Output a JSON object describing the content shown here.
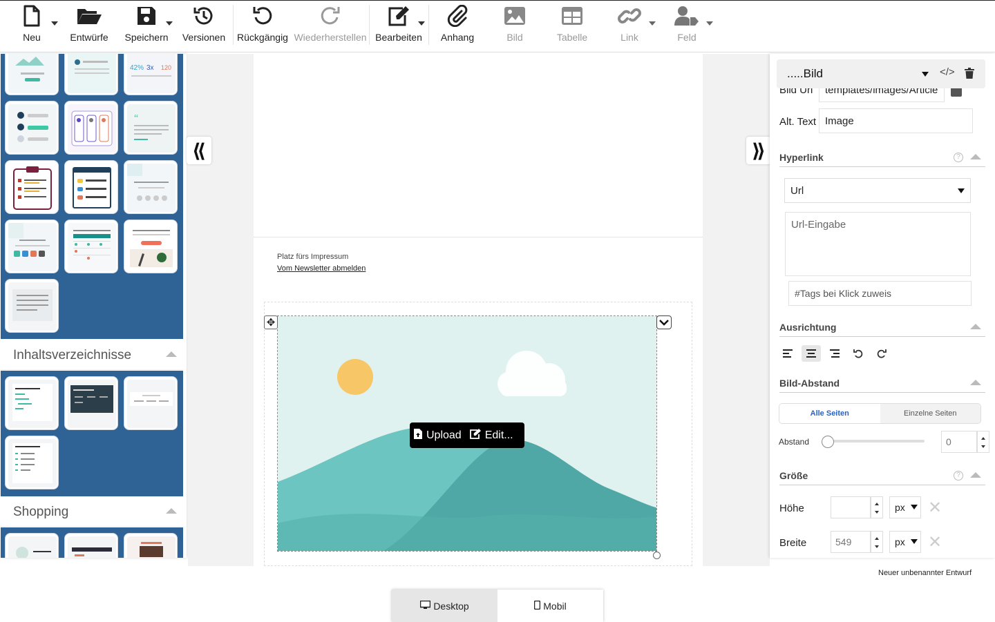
{
  "toolbar": {
    "new": "Neu",
    "drafts": "Entwürfe",
    "save": "Speichern",
    "versions": "Versionen",
    "undo": "Rückgängig",
    "redo": "Wiederherstellen",
    "edit": "Bearbeiten",
    "attachment": "Anhang",
    "image": "Bild",
    "table": "Tabelle",
    "link": "Link",
    "field": "Feld"
  },
  "left_panel": {
    "toc_title": "Inhaltsverzeichnisse",
    "shopping_title": "Shopping",
    "top_tile_stats": [
      "42%",
      "3x",
      "120"
    ]
  },
  "canvas": {
    "impressum": "Platz fürs Impressum",
    "unsubscribe": "Vom Newsletter abmelden",
    "upload": "Upload",
    "edit": "Edit..."
  },
  "right_panel": {
    "header": ".....Bild",
    "image_url_label": "Bild Url",
    "image_url_value": "templates/images/Article",
    "alt_label": "Alt. Text",
    "alt_value": "Image",
    "hyperlink_title": "Hyperlink",
    "link_type": "Url",
    "url_placeholder": "Url-Eingabe",
    "tags_placeholder": "#Tags bei Klick zuweis",
    "alignment_title": "Ausrichtung",
    "spacing_title": "Bild-Abstand",
    "all_sides": "Alle Seiten",
    "single_sides": "Einzelne Seiten",
    "spacing_label": "Abstand",
    "spacing_value": "0",
    "size_title": "Größe",
    "height_label": "Höhe",
    "height_value": "",
    "height_unit": "px",
    "width_label": "Breite",
    "width_value": "549",
    "width_unit": "px"
  },
  "footer": {
    "draft_name": "Neuer unbenannter Entwurf",
    "desktop": "Desktop",
    "mobile": "Mobil"
  },
  "colors": {
    "template_bg": "#2f6396",
    "image_bg": "#dff2ef",
    "mountain_light": "#6cc5c0",
    "mountain_dark": "#4fa8a5",
    "sun": "#f7c666",
    "active_tab": "#2563c4"
  }
}
